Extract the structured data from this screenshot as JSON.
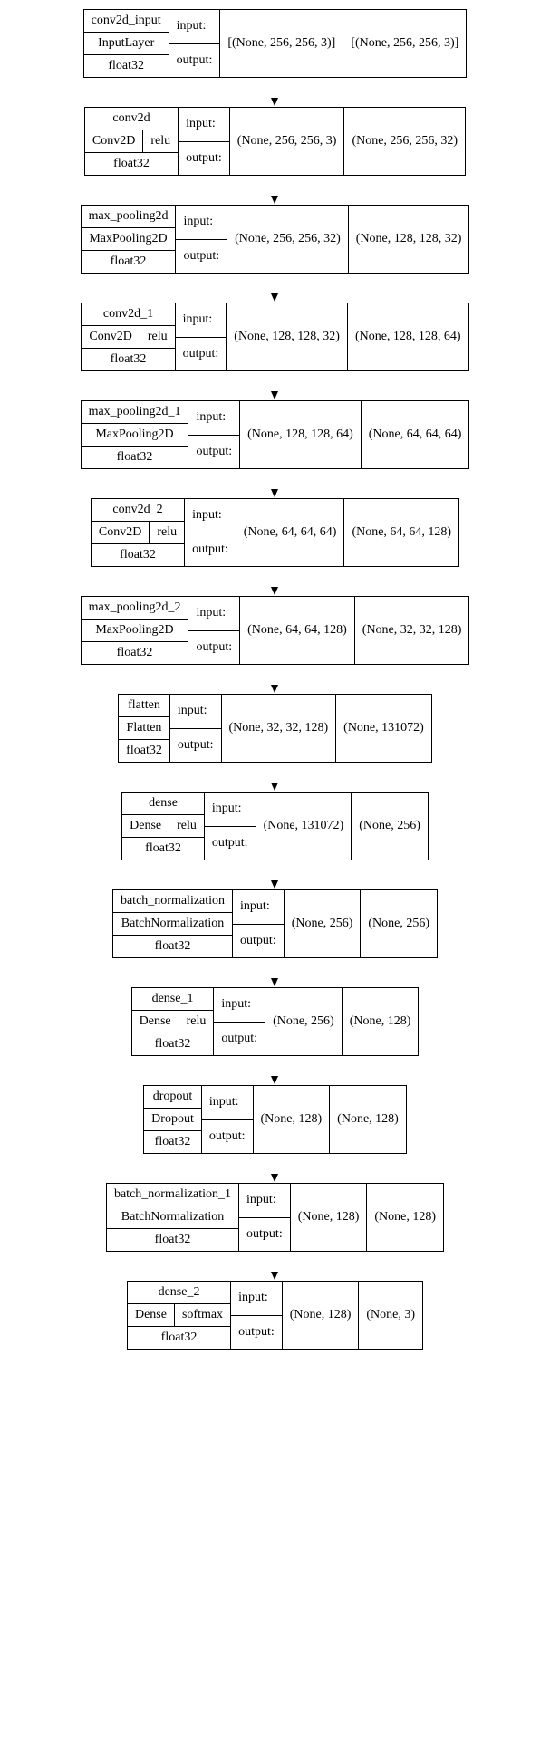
{
  "io_labels": {
    "input": "input:",
    "output": "output:"
  },
  "layers": [
    {
      "name": "conv2d_input",
      "type": "InputLayer",
      "act": null,
      "dtype": "float32",
      "in": "[(None, 256, 256, 3)]",
      "out": "[(None, 256, 256, 3)]"
    },
    {
      "name": "conv2d",
      "type": "Conv2D",
      "act": "relu",
      "dtype": "float32",
      "in": "(None, 256, 256, 3)",
      "out": "(None, 256, 256, 32)"
    },
    {
      "name": "max_pooling2d",
      "type": "MaxPooling2D",
      "act": null,
      "dtype": "float32",
      "in": "(None, 256, 256, 32)",
      "out": "(None, 128, 128, 32)"
    },
    {
      "name": "conv2d_1",
      "type": "Conv2D",
      "act": "relu",
      "dtype": "float32",
      "in": "(None, 128, 128, 32)",
      "out": "(None, 128, 128, 64)"
    },
    {
      "name": "max_pooling2d_1",
      "type": "MaxPooling2D",
      "act": null,
      "dtype": "float32",
      "in": "(None, 128, 128, 64)",
      "out": "(None, 64, 64, 64)"
    },
    {
      "name": "conv2d_2",
      "type": "Conv2D",
      "act": "relu",
      "dtype": "float32",
      "in": "(None, 64, 64, 64)",
      "out": "(None, 64, 64, 128)"
    },
    {
      "name": "max_pooling2d_2",
      "type": "MaxPooling2D",
      "act": null,
      "dtype": "float32",
      "in": "(None, 64, 64, 128)",
      "out": "(None, 32, 32, 128)"
    },
    {
      "name": "flatten",
      "type": "Flatten",
      "act": null,
      "dtype": "float32",
      "in": "(None, 32, 32, 128)",
      "out": "(None, 131072)"
    },
    {
      "name": "dense",
      "type": "Dense",
      "act": "relu",
      "dtype": "float32",
      "in": "(None, 131072)",
      "out": "(None, 256)"
    },
    {
      "name": "batch_normalization",
      "type": "BatchNormalization",
      "act": null,
      "dtype": "float32",
      "in": "(None, 256)",
      "out": "(None, 256)"
    },
    {
      "name": "dense_1",
      "type": "Dense",
      "act": "relu",
      "dtype": "float32",
      "in": "(None, 256)",
      "out": "(None, 128)"
    },
    {
      "name": "dropout",
      "type": "Dropout",
      "act": null,
      "dtype": "float32",
      "in": "(None, 128)",
      "out": "(None, 128)"
    },
    {
      "name": "batch_normalization_1",
      "type": "BatchNormalization",
      "act": null,
      "dtype": "float32",
      "in": "(None, 128)",
      "out": "(None, 128)"
    },
    {
      "name": "dense_2",
      "type": "Dense",
      "act": "softmax",
      "dtype": "float32",
      "in": "(None, 128)",
      "out": "(None, 3)"
    }
  ]
}
